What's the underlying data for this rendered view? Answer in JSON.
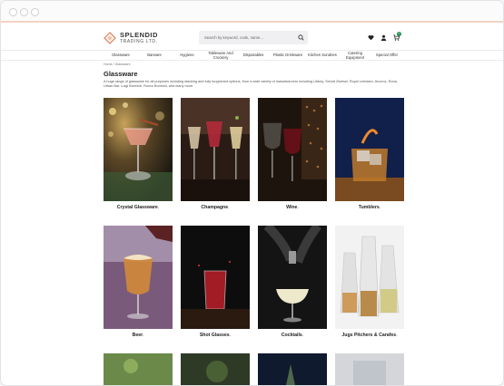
{
  "logo": {
    "line1": "SPLENDID",
    "line2": "TRADING LTD."
  },
  "search": {
    "placeholder": "Search by keyword, code, name..."
  },
  "cart": {
    "count": "0"
  },
  "nav": {
    "items": [
      "Glassware",
      "Barware",
      "Hygiene",
      "Tableware And Crockery",
      "Disposables",
      "Plastic Drinkware",
      "Kitchen Sundries",
      "Catering Equipment",
      "Special Offer"
    ]
  },
  "breadcrumb": {
    "home": "Home",
    "separator": "/",
    "current": "Glassware"
  },
  "page": {
    "title": "Glassware",
    "intro": "A huge range of glassware for all purposes including stacking and fully toughened options, from a wide variety of manufacturers including Libbey, Schott Zwiesel, Royal Leerdam, Arcoroc, Rona, Urban Bar, Luigi Bormioli, Rocco Bormioli, and many more."
  },
  "categories": [
    {
      "label": "Crystal Glassware"
    },
    {
      "label": "Champagne"
    },
    {
      "label": "Wine"
    },
    {
      "label": "Tumblers"
    },
    {
      "label": "Beer"
    },
    {
      "label": "Shot Glasses"
    },
    {
      "label": "Cocktails"
    },
    {
      "label": "Jugs Pitchers & Carafes"
    }
  ],
  "colors": {
    "accent": "#e07a50",
    "cart_badge": "#1f8a4c",
    "chrome_rule": "#f1d3c4"
  }
}
